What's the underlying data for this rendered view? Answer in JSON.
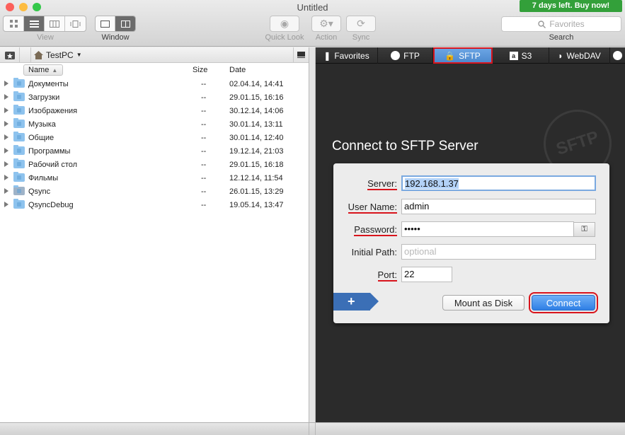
{
  "window": {
    "title": "Untitled"
  },
  "toolbar": {
    "view_label": "View",
    "window_label": "Window",
    "quicklook_label": "Quick Look",
    "action_label": "Action",
    "sync_label": "Sync",
    "search_label": "Search",
    "search_placeholder": "Favorites",
    "buy_label": "7 days left. Buy now!"
  },
  "browser": {
    "location": "TestPC",
    "columns": {
      "name": "Name",
      "size": "Size",
      "date": "Date"
    },
    "rows": [
      {
        "name": "Документы",
        "size": "--",
        "date": "02.04.14, 14:41"
      },
      {
        "name": "Загрузки",
        "size": "--",
        "date": "29.01.15, 16:16"
      },
      {
        "name": "Изображения",
        "size": "--",
        "date": "30.12.14, 14:06"
      },
      {
        "name": "Музыка",
        "size": "--",
        "date": "30.01.14, 13:11"
      },
      {
        "name": "Общие",
        "size": "--",
        "date": "30.01.14, 12:40"
      },
      {
        "name": "Программы",
        "size": "--",
        "date": "19.12.14, 21:03"
      },
      {
        "name": "Рабочий стол",
        "size": "--",
        "date": "29.01.15, 16:18"
      },
      {
        "name": "Фильмы",
        "size": "--",
        "date": "12.12.14, 11:54"
      },
      {
        "name": "Qsync",
        "size": "--",
        "date": "26.01.15, 13:29"
      },
      {
        "name": "QsyncDebug",
        "size": "--",
        "date": "19.05.14, 13:47"
      }
    ]
  },
  "connect": {
    "tabs": [
      "Favorites",
      "FTP",
      "SFTP",
      "S3",
      "WebDAV"
    ],
    "active_tab": "SFTP",
    "heading": "Connect to SFTP Server",
    "stamp": "SFTP",
    "server_label": "Server:",
    "server_value": "192.168.1.37",
    "user_label": "User Name:",
    "user_value": "admin",
    "password_label": "Password:",
    "password_value": "•••••",
    "path_label": "Initial Path:",
    "path_placeholder": "optional",
    "port_label": "Port:",
    "port_value": "22",
    "mount_label": "Mount as Disk",
    "connect_label": "Connect",
    "plus_label": "+"
  },
  "colors": {
    "accent": "#2f7fe5",
    "highlight_outline": "#d8141c",
    "buy_green": "#33a03a",
    "dark_panel": "#2b2b2b"
  }
}
